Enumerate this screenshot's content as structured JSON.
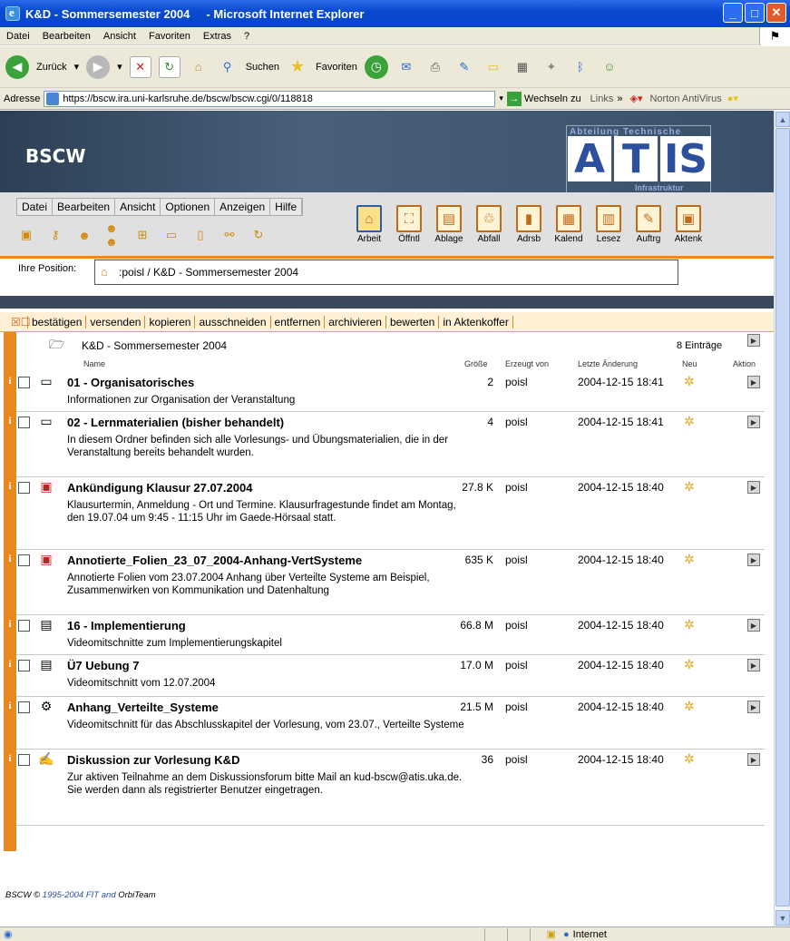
{
  "window": {
    "title": "K&D - Sommersemester 2004",
    "app": "- Microsoft Internet Explorer"
  },
  "menu": [
    "Datei",
    "Bearbeiten",
    "Ansicht",
    "Favoriten",
    "Extras",
    "?"
  ],
  "toolbar": {
    "back": "Zurück",
    "search": "Suchen",
    "favorites": "Favoriten"
  },
  "address": {
    "label": "Adresse",
    "url": "https://bscw.ira.uni-karlsruhe.de/bscw/bscw.cgi/0/118818",
    "go": "Wechseln zu",
    "links": "Links",
    "norton": "Norton AntiVirus"
  },
  "bscw": {
    "logo": "BSCW",
    "atis_top": "Abteilung Technische",
    "atis_letters": [
      "A",
      "T",
      "IS"
    ],
    "atis_sub": "Infrastruktur",
    "appmenu": [
      "Datei",
      "Bearbeiten",
      "Ansicht",
      "Optionen",
      "Anzeigen",
      "Hilfe"
    ],
    "bigbuttons": [
      "Arbeit",
      "Öffntl",
      "Ablage",
      "Abfall",
      "Adrsb",
      "Kalend",
      "Lesez",
      "Auftrg",
      "Aktenk"
    ],
    "position_label": "Ihre Position:",
    "position_path": ":poisl / K&D - Sommersemester 2004",
    "actions": [
      "bestätigen",
      "versenden",
      "kopieren",
      "ausschneiden",
      "entfernen",
      "archivieren",
      "bewerten",
      "in Aktenkoffer"
    ],
    "folder_title": "K&D - Sommersemester 2004",
    "count": "8 Einträge",
    "columns": {
      "name": "Name",
      "size": "Größe",
      "by": "Erzeugt von",
      "changed": "Letzte Änderung",
      "new": "Neu",
      "action": "Aktion"
    },
    "items": [
      {
        "name": "01 - Organisatorisches",
        "icon": "folder-icon",
        "size": "2",
        "by": "poisl",
        "date": "2004-12-15 18:41",
        "desc": "Informationen zur Organisation der Veranstaltung"
      },
      {
        "name": "02 - Lernmaterialien (bisher behandelt)",
        "icon": "folder-icon",
        "size": "4",
        "by": "poisl",
        "date": "2004-12-15 18:41",
        "desc": "In diesem Ordner befinden sich alle Vorlesungs- und Übungsmaterialien, die in der Veranstaltung bereits behandelt wurden."
      },
      {
        "name": "Ankündigung Klausur 27.07.2004",
        "icon": "pdf-icon",
        "size": "27.8 K",
        "by": "poisl",
        "date": "2004-12-15 18:40",
        "desc": "Klausurtermin, Anmeldung - Ort und Termine. Klausurfragestunde findet am Montag, den 19.07.04 um 9:45 - 11:15 Uhr im Gaede-Hörsaal statt."
      },
      {
        "name": "Annotierte_Folien_23_07_2004-Anhang-VertSysteme",
        "icon": "pdf-icon",
        "size": "635 K",
        "by": "poisl",
        "date": "2004-12-15 18:40",
        "desc": "Annotierte Folien vom 23.07.2004 Anhang über Verteilte Systeme am Beispiel, Zusammenwirken von Kommunikation und Datenhaltung"
      },
      {
        "name": "16 - Implementierung",
        "icon": "zip-icon",
        "size": "66.8 M",
        "by": "poisl",
        "date": "2004-12-15 18:40",
        "desc": "Videomitschnitte zum Implementierungskapitel"
      },
      {
        "name": "Ü7 Uebung 7",
        "icon": "zip-icon",
        "size": "17.0 M",
        "by": "poisl",
        "date": "2004-12-15 18:40",
        "desc": "Videomitschnitt vom 12.07.2004"
      },
      {
        "name": "Anhang_Verteilte_Systeme",
        "icon": "video-icon",
        "size": "21.5 M",
        "by": "poisl",
        "date": "2004-12-15 18:40",
        "desc": "Videomitschnitt für das Abschlusskapitel der Vorlesung, vom 23.07., Verteilte Systeme"
      },
      {
        "name": "Diskussion zur Vorlesung K&D",
        "icon": "discussion-icon",
        "size": "36",
        "by": "poisl",
        "date": "2004-12-15 18:40",
        "desc": "Zur aktiven Teilnahme an dem Diskussionsforum bitte Mail an kud-bscw@atis.uka.de. Sie werden dann als registrierter Benutzer eingetragen."
      }
    ],
    "footer_a": "BSCW © ",
    "footer_b": "1995-2004 FIT",
    "footer_c": " and ",
    "footer_d": "OrbiTeam"
  },
  "status": {
    "zone": "Internet"
  }
}
